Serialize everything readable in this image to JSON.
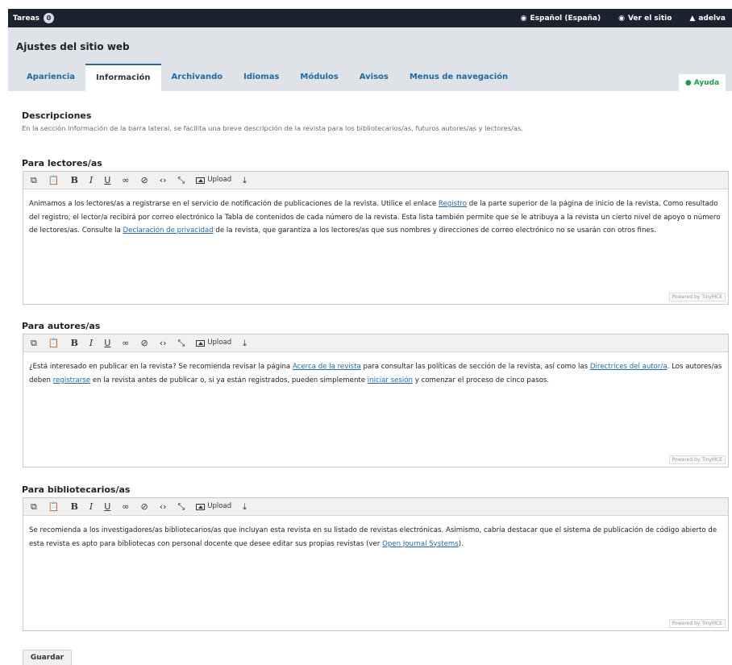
{
  "topbar": {
    "tasks_label": "Tareas",
    "tasks_count": "0",
    "language": "Español (España)",
    "view_site": "Ver el sitio",
    "user": "adelva"
  },
  "header": {
    "title": "Ajustes del sitio web",
    "tabs": [
      {
        "label": "Apariencia"
      },
      {
        "label": "Información"
      },
      {
        "label": "Archivando"
      },
      {
        "label": "Idiomas"
      },
      {
        "label": "Módulos"
      },
      {
        "label": "Avisos"
      },
      {
        "label": "Menus de navegación"
      }
    ],
    "active_tab": "Información",
    "help_label": "Ayuda"
  },
  "descriptions": {
    "title": "Descripciones",
    "text": "En la sección Información de la barra lateral, se facilita una breve descripción de la revista para los bibliotecarios/as, futuros autores/as y lectores/as."
  },
  "toolbar": {
    "upload_label": "Upload",
    "icons": [
      "copy-icon",
      "paste-icon",
      "bold-icon",
      "italic-icon",
      "underline-icon",
      "link-icon",
      "unlink-icon",
      "code-icon",
      "fullscreen-icon",
      "upload-icon",
      "download-icon"
    ]
  },
  "powered_by": "Powered by TinyMCE",
  "editors": {
    "readers": {
      "label": "Para lectores/as",
      "t1": "Animamos a los lectores/as a registrarse en el servicio de notificación de publicaciones de la revista. Utilice el enlace ",
      "l1": "Registro",
      "t2": " de la parte superior de la página de inicio de la revista. Como resultado del registro, el lector/a recibirá por correo electrónico la Tabla de contenidos de cada número de la revista. Esta lista también permite que se le atribuya a la revista un cierto nivel de apoyo o número de lectores/as. Consulte la ",
      "l2": "Declaración de privacidad",
      "t3": " de la revista, que garantiza a los lectores/as que sus nombres y direcciones de correo electrónico no se usarán con otros fines."
    },
    "authors": {
      "label": "Para autores/as",
      "t1": "¿Está interesado en publicar en la revista? Se recomienda revisar la página ",
      "l1": "Acerca de la revista",
      "t2": " para consultar las políticas de sección de la revista, así como las ",
      "l2": "Directrices del autor/a",
      "t3": ". Los autores/as deben ",
      "l3": "registrarse",
      "t4": " en la revista antes de publicar o, si ya están registrados, pueden simplemente ",
      "l4": "iniciar sesión",
      "t5": " y comenzar el proceso de cinco pasos."
    },
    "librarians": {
      "label": "Para bibliotecarios/as",
      "t1": "Se recomienda a los investigadores/as bibliotecarios/as que incluyan esta revista en su listado de revistas electrónicas. Asimismo, cabría destacar que el sistema de publicación de código abierto de esta revista es apto para bibliotecas con personal docente que desee editar sus propias revistas (ver ",
      "l1": "Open Journal Systems",
      "t2": ")."
    }
  },
  "save_label": "Guardar"
}
